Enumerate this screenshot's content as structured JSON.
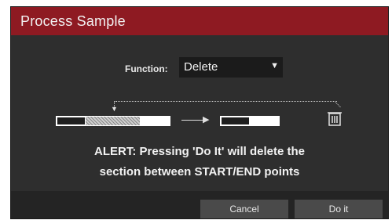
{
  "dialog": {
    "title": "Process Sample",
    "function": {
      "label": "Function:",
      "selected": "Delete"
    },
    "alert_line1": "ALERT: Pressing 'Do It' will delete the",
    "alert_line2": "section between START/END points",
    "buttons": {
      "cancel": "Cancel",
      "do_it": "Do it"
    }
  },
  "colors": {
    "titlebar": "#8e1a22",
    "body": "#2e2e2e",
    "footer": "#242424",
    "button": "#4a4a4a"
  },
  "icons": [
    "chevron-down-icon",
    "trash-icon",
    "arrow-right-icon",
    "arrow-down-icon"
  ]
}
